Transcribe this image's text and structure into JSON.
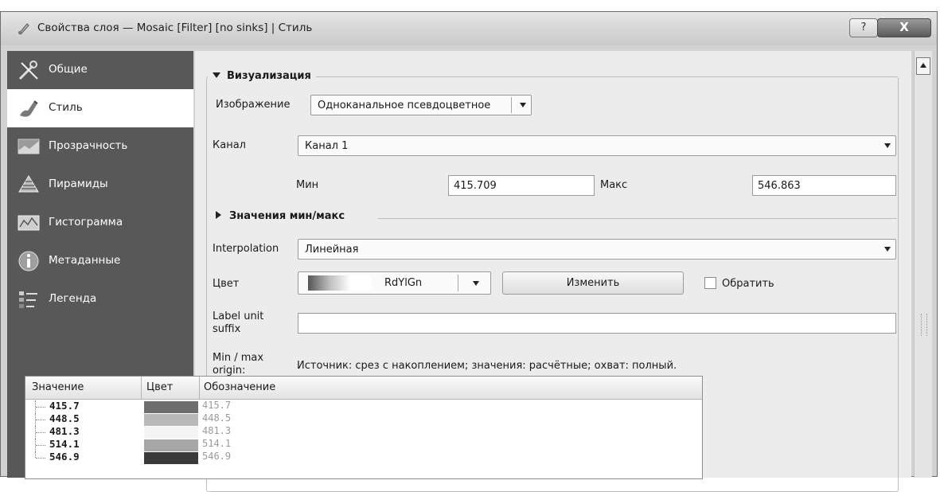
{
  "window": {
    "title": "Свойства слоя — Mosaic [Filter] [no sinks] | Стиль",
    "help_label": "?",
    "close_label": "X"
  },
  "sidebar": {
    "items": [
      {
        "label": "Общие",
        "icon": "tools-icon"
      },
      {
        "label": "Стиль",
        "icon": "brush-icon",
        "active": true
      },
      {
        "label": "Прозрачность",
        "icon": "transparency-icon"
      },
      {
        "label": "Пирамиды",
        "icon": "pyramid-icon"
      },
      {
        "label": "Гистограмма",
        "icon": "histogram-icon"
      },
      {
        "label": "Метаданные",
        "icon": "info-icon"
      },
      {
        "label": "Легенда",
        "icon": "legend-icon"
      }
    ]
  },
  "render": {
    "section_title": "Визуализация",
    "render_type_label": "Изображение",
    "render_type_value": "Одноканальное псевдоцветное",
    "band_label": "Канал",
    "band_value": "Канал 1",
    "min_label": "Мин",
    "min_value": "415.709",
    "max_label": "Макс",
    "max_value": "546.863",
    "minmax_section_title": "Значения мин/макс",
    "interpolation_label": "Interpolation",
    "interpolation_value": "Линейная",
    "color_label": "Цвет",
    "color_ramp_name": "RdYlGn",
    "edit_button": "Изменить",
    "invert_label": "Обратить",
    "label_unit_suffix_label": "Label unit suffix",
    "label_unit_suffix_value": "",
    "minmax_origin_label": "Min / max origin:",
    "minmax_origin_value": "Источник: срез с накоплением; значения: расчётные; охват: полный."
  },
  "table": {
    "headers": [
      "Значение",
      "Цвет",
      "Обозначение"
    ],
    "rows": [
      {
        "value": "415.7",
        "color": "#6e6e6e",
        "label": "415.7"
      },
      {
        "value": "448.5",
        "color": "#b9b9b9",
        "label": "448.5"
      },
      {
        "value": "481.3",
        "color": "#f4f4f4",
        "label": "481.3"
      },
      {
        "value": "514.1",
        "color": "#a6a6a6",
        "label": "514.1"
      },
      {
        "value": "546.9",
        "color": "#3a3a3a",
        "label": "546.9"
      }
    ]
  }
}
